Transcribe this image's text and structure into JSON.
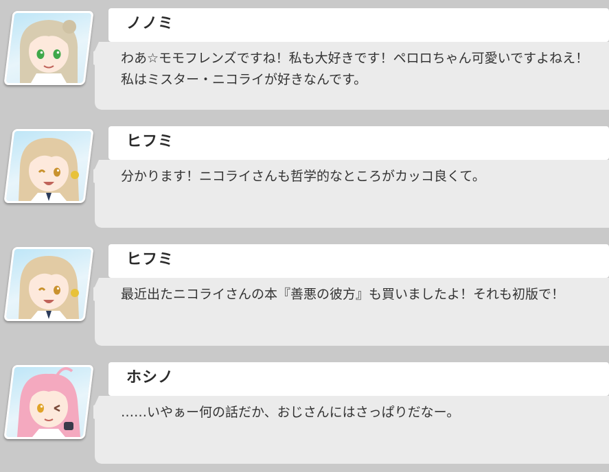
{
  "chat": {
    "messages": [
      {
        "speaker": "ノノミ",
        "avatar_icon": "nonomi-portrait-icon",
        "hair_color": "#d8ccb0",
        "eye_color": "#3fa84a",
        "text": "わあ☆モモフレンズですね！私も大好きです！ペロロちゃん可愛いですよねえ！\n私はミスター・ニコライが好きなんです。"
      },
      {
        "speaker": "ヒフミ",
        "avatar_icon": "hifumi-portrait-icon",
        "hair_color": "#e2cba4",
        "eye_color": "#c9922e",
        "text": "分かります！ニコライさんも哲学的なところがカッコ良くて。"
      },
      {
        "speaker": "ヒフミ",
        "avatar_icon": "hifumi-portrait-icon",
        "hair_color": "#e2cba4",
        "eye_color": "#c9922e",
        "text": "最近出たニコライさんの本『善悪の彼方』も買いましたよ！それも初版で！"
      },
      {
        "speaker": "ホシノ",
        "avatar_icon": "hoshino-portrait-icon",
        "hair_color": "#f4a9bf",
        "eye_color": "#e0a328",
        "text": "……いやぁー何の話だか、おじさんにはさっぱりだなー。"
      }
    ]
  },
  "colors": {
    "background": "#c9c9c9",
    "bubble_name_band": "#ffffff",
    "bubble_body": "#ebebeb",
    "text": "#333333"
  }
}
